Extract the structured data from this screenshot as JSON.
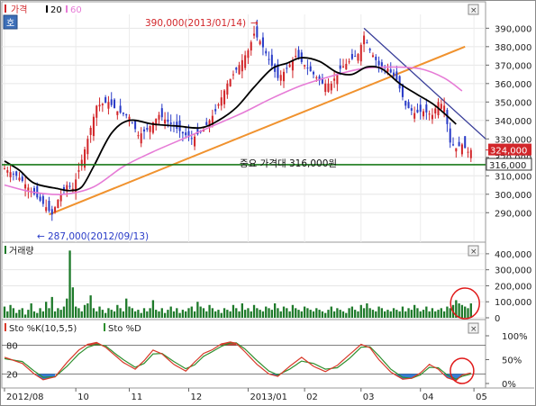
{
  "legend": {
    "price_icon": "candle-icon",
    "price_label": "가격",
    "ma20_label": "20",
    "ma60_label": "60",
    "corner_badge": "호",
    "volume_label": "거래량",
    "sto_k_label": "Sto %K(10,5,5)",
    "sto_d_label": "Sto %D"
  },
  "colors": {
    "up": "#d2262a",
    "down": "#2a3cc8",
    "ma20": "#000000",
    "ma60": "#e67bd6",
    "trend_up": "#f0922e",
    "trend_down": "#3a3f9a",
    "support": "#1a7a1a",
    "volume": "#1e7a2a",
    "sto_k": "#d83a2a",
    "sto_d": "#2e8f2e",
    "circle": "#e01818",
    "overbought_fill": "#c03020",
    "oversold_fill": "#2070d0"
  },
  "annotations": {
    "high": "390,000(2013/01/14)",
    "high_arrow": "→",
    "low": "287,000(2012/09/13)",
    "low_arrow": "←",
    "support": "중요 가격대 316,000원"
  },
  "badges": {
    "current": "324,000",
    "support": "316,000"
  },
  "chart_data": [
    {
      "type": "candlestick",
      "title": "",
      "ylim": [
        275000,
        397000
      ],
      "y_ticks": [
        290000,
        300000,
        310000,
        320000,
        330000,
        340000,
        350000,
        360000,
        370000,
        380000,
        390000
      ],
      "y_tick_labels": [
        "290,000",
        "300,000",
        "310,000",
        "320,000",
        "330,000",
        "340,000",
        "350,000",
        "360,000",
        "370,000",
        "380,000",
        "390,000"
      ],
      "x_tick_labels": [
        "2012/08",
        "10",
        "11",
        "12",
        "2013/01",
        "02",
        "03",
        "04",
        "05"
      ],
      "x_tick_index": [
        0,
        24,
        42,
        62,
        82,
        101,
        120,
        140,
        158
      ],
      "n_slots": 162,
      "close_anchors": [
        [
          0,
          314000
        ],
        [
          5,
          309000
        ],
        [
          10,
          300000
        ],
        [
          14,
          293000
        ],
        [
          16,
          289000
        ],
        [
          18,
          297000
        ],
        [
          21,
          305000
        ],
        [
          23,
          303000
        ],
        [
          25,
          313000
        ],
        [
          28,
          330000
        ],
        [
          31,
          348000
        ],
        [
          35,
          350000
        ],
        [
          38,
          345000
        ],
        [
          42,
          342000
        ],
        [
          45,
          332000
        ],
        [
          48,
          335000
        ],
        [
          52,
          343000
        ],
        [
          56,
          338000
        ],
        [
          60,
          333000
        ],
        [
          63,
          330000
        ],
        [
          67,
          335000
        ],
        [
          71,
          345000
        ],
        [
          75,
          360000
        ],
        [
          79,
          370000
        ],
        [
          82,
          378000
        ],
        [
          84,
          387000
        ],
        [
          86,
          383000
        ],
        [
          89,
          373000
        ],
        [
          92,
          363000
        ],
        [
          95,
          368000
        ],
        [
          98,
          375000
        ],
        [
          101,
          370000
        ],
        [
          104,
          365000
        ],
        [
          107,
          360000
        ],
        [
          110,
          360000
        ],
        [
          113,
          368000
        ],
        [
          116,
          372000
        ],
        [
          119,
          376000
        ],
        [
          121,
          386000
        ],
        [
          123,
          378000
        ],
        [
          126,
          370000
        ],
        [
          129,
          368000
        ],
        [
          132,
          362000
        ],
        [
          135,
          348000
        ],
        [
          138,
          344000
        ],
        [
          141,
          345000
        ],
        [
          144,
          343000
        ],
        [
          146,
          350000
        ],
        [
          148,
          348000
        ],
        [
          150,
          328000
        ],
        [
          152,
          325000
        ],
        [
          154,
          327000
        ],
        [
          156,
          323000
        ],
        [
          157,
          324000
        ]
      ],
      "ma20_anchors": [
        [
          0,
          318000
        ],
        [
          5,
          313000
        ],
        [
          10,
          306000
        ],
        [
          18,
          303000
        ],
        [
          22,
          302000
        ],
        [
          26,
          304000
        ],
        [
          30,
          315000
        ],
        [
          36,
          333000
        ],
        [
          42,
          340000
        ],
        [
          50,
          338000
        ],
        [
          58,
          337000
        ],
        [
          66,
          336000
        ],
        [
          72,
          340000
        ],
        [
          78,
          347000
        ],
        [
          84,
          358000
        ],
        [
          90,
          368000
        ],
        [
          95,
          371000
        ],
        [
          100,
          374000
        ],
        [
          106,
          372000
        ],
        [
          112,
          366000
        ],
        [
          117,
          365000
        ],
        [
          122,
          369000
        ],
        [
          127,
          368000
        ],
        [
          133,
          360000
        ],
        [
          139,
          354000
        ],
        [
          145,
          348000
        ],
        [
          152,
          338000
        ]
      ],
      "ma60_anchors": [
        [
          0,
          305000
        ],
        [
          10,
          301000
        ],
        [
          20,
          300000
        ],
        [
          30,
          304000
        ],
        [
          40,
          315000
        ],
        [
          50,
          323000
        ],
        [
          60,
          330000
        ],
        [
          70,
          337000
        ],
        [
          80,
          344000
        ],
        [
          90,
          352000
        ],
        [
          100,
          359000
        ],
        [
          110,
          364000
        ],
        [
          120,
          368000
        ],
        [
          130,
          369000
        ],
        [
          140,
          368000
        ],
        [
          148,
          363000
        ],
        [
          154,
          356000
        ]
      ],
      "support_value": 316000,
      "current_value": 324000,
      "high": {
        "value": 390000,
        "date": "2013/01/14"
      },
      "low": {
        "value": 287000,
        "date": "2012/09/13"
      },
      "trend_up_line": [
        [
          15,
          289000
        ],
        [
          155,
          380000
        ]
      ],
      "trend_down_line": [
        [
          121,
          390000
        ],
        [
          164,
          327000
        ]
      ]
    },
    {
      "type": "bar",
      "title": "",
      "ylim": [
        0,
        450000
      ],
      "y_ticks": [
        0,
        100000,
        200000,
        300000,
        400000
      ],
      "y_tick_labels": [
        "0",
        "100,000",
        "200,000",
        "300,000",
        "400,000"
      ],
      "values": [
        70000,
        40000,
        80000,
        60000,
        30000,
        50000,
        60000,
        20000,
        50000,
        90000,
        40000,
        30000,
        60000,
        40000,
        100000,
        60000,
        130000,
        40000,
        60000,
        50000,
        70000,
        120000,
        420000,
        190000,
        70000,
        60000,
        40000,
        80000,
        90000,
        140000,
        60000,
        40000,
        70000,
        50000,
        30000,
        60000,
        50000,
        40000,
        80000,
        60000,
        40000,
        120000,
        70000,
        60000,
        40000,
        50000,
        30000,
        60000,
        40000,
        60000,
        110000,
        50000,
        40000,
        60000,
        30000,
        50000,
        70000,
        40000,
        60000,
        30000,
        50000,
        40000,
        60000,
        70000,
        40000,
        100000,
        70000,
        60000,
        40000,
        80000,
        60000,
        40000,
        50000,
        30000,
        60000,
        50000,
        40000,
        80000,
        60000,
        40000,
        90000,
        50000,
        60000,
        40000,
        80000,
        60000,
        50000,
        40000,
        70000,
        60000,
        50000,
        90000,
        60000,
        40000,
        70000,
        60000,
        40000,
        80000,
        60000,
        50000,
        40000,
        70000,
        60000,
        50000,
        40000,
        60000,
        50000,
        40000,
        30000,
        50000,
        70000,
        40000,
        60000,
        50000,
        40000,
        30000,
        60000,
        70000,
        50000,
        40000,
        80000,
        60000,
        90000,
        60000,
        50000,
        40000,
        70000,
        60000,
        40000,
        50000,
        40000,
        60000,
        50000,
        40000,
        70000,
        40000,
        60000,
        50000,
        80000,
        60000,
        40000,
        50000,
        70000,
        40000,
        60000,
        40000,
        50000,
        60000,
        40000,
        70000,
        60000,
        80000,
        110000,
        90000,
        80000,
        70000,
        60000,
        90000
      ],
      "circle_slot": 155
    },
    {
      "type": "line",
      "title": "",
      "ylim": [
        0,
        100
      ],
      "y_ticks_right": [
        0,
        50,
        100
      ],
      "y_tick_labels_right": [
        "0%",
        "50%",
        "100%"
      ],
      "ref_levels": [
        20,
        80
      ],
      "ref_labels": [
        "20",
        "80"
      ],
      "series": [
        {
          "name": "Sto %K(10,5,5)",
          "anchors": [
            [
              0,
              55
            ],
            [
              6,
              42
            ],
            [
              10,
              20
            ],
            [
              13,
              8
            ],
            [
              17,
              14
            ],
            [
              21,
              44
            ],
            [
              25,
              70
            ],
            [
              28,
              82
            ],
            [
              31,
              86
            ],
            [
              34,
              76
            ],
            [
              37,
              60
            ],
            [
              40,
              44
            ],
            [
              44,
              30
            ],
            [
              47,
              48
            ],
            [
              50,
              70
            ],
            [
              53,
              62
            ],
            [
              57,
              40
            ],
            [
              61,
              26
            ],
            [
              64,
              45
            ],
            [
              67,
              63
            ],
            [
              70,
              71
            ],
            [
              73,
              83
            ],
            [
              76,
              87
            ],
            [
              78,
              84
            ],
            [
              81,
              66
            ],
            [
              85,
              40
            ],
            [
              89,
              20
            ],
            [
              92,
              15
            ],
            [
              96,
              36
            ],
            [
              100,
              55
            ],
            [
              104,
              36
            ],
            [
              108,
              25
            ],
            [
              112,
              38
            ],
            [
              116,
              60
            ],
            [
              120,
              82
            ],
            [
              123,
              75
            ],
            [
              126,
              50
            ],
            [
              130,
              24
            ],
            [
              134,
              9
            ],
            [
              137,
              11
            ],
            [
              140,
              22
            ],
            [
              143,
              40
            ],
            [
              146,
              30
            ],
            [
              149,
              12
            ],
            [
              152,
              6
            ],
            [
              154,
              18
            ],
            [
              157,
              22
            ]
          ]
        },
        {
          "name": "Sto %D",
          "anchors": [
            [
              0,
              52
            ],
            [
              6,
              46
            ],
            [
              10,
              26
            ],
            [
              13,
              13
            ],
            [
              17,
              14
            ],
            [
              21,
              36
            ],
            [
              25,
              62
            ],
            [
              28,
              76
            ],
            [
              31,
              82
            ],
            [
              34,
              79
            ],
            [
              37,
              64
            ],
            [
              40,
              50
            ],
            [
              44,
              34
            ],
            [
              47,
              42
            ],
            [
              50,
              62
            ],
            [
              53,
              63
            ],
            [
              57,
              46
            ],
            [
              61,
              31
            ],
            [
              64,
              39
            ],
            [
              67,
              57
            ],
            [
              70,
              67
            ],
            [
              73,
              78
            ],
            [
              76,
              85
            ],
            [
              78,
              85
            ],
            [
              81,
              72
            ],
            [
              85,
              48
            ],
            [
              89,
              26
            ],
            [
              92,
              18
            ],
            [
              96,
              30
            ],
            [
              100,
              47
            ],
            [
              104,
              42
            ],
            [
              108,
              30
            ],
            [
              112,
              33
            ],
            [
              116,
              52
            ],
            [
              120,
              76
            ],
            [
              123,
              77
            ],
            [
              126,
              58
            ],
            [
              130,
              30
            ],
            [
              134,
              13
            ],
            [
              137,
              11
            ],
            [
              140,
              18
            ],
            [
              143,
              34
            ],
            [
              146,
              33
            ],
            [
              149,
              18
            ],
            [
              152,
              9
            ],
            [
              154,
              15
            ],
            [
              157,
              20
            ]
          ]
        }
      ],
      "circle_slot": 154
    }
  ]
}
